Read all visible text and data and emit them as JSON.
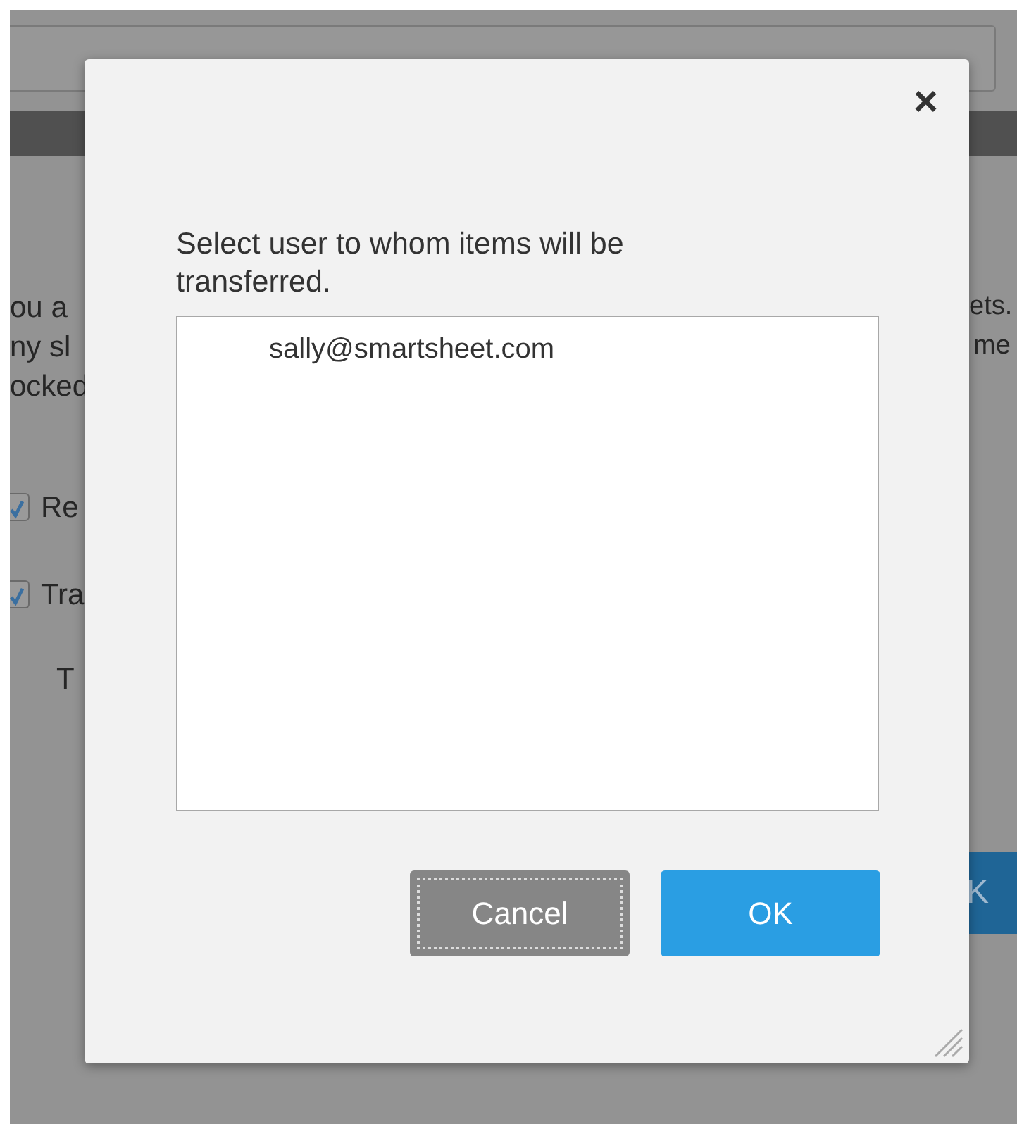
{
  "background": {
    "paragraph_fragments": [
      "ou a",
      "ny sl",
      "ocked"
    ],
    "options": [
      {
        "label": "Re",
        "checked": true
      },
      {
        "label": "Tra",
        "checked": true
      }
    ],
    "sub_label": "T",
    "right_fragments": [
      "ets.",
      "me"
    ],
    "button": "K"
  },
  "dialog": {
    "close": "×",
    "prompt": "Select user to whom items will be transferred.",
    "users": [
      {
        "email": "sally@smartsheet.com",
        "selected": false
      }
    ],
    "buttons": [
      {
        "label": "Cancel",
        "kind": "secondary",
        "focused": true
      },
      {
        "label": "OK",
        "kind": "primary",
        "focused": false
      }
    ]
  }
}
